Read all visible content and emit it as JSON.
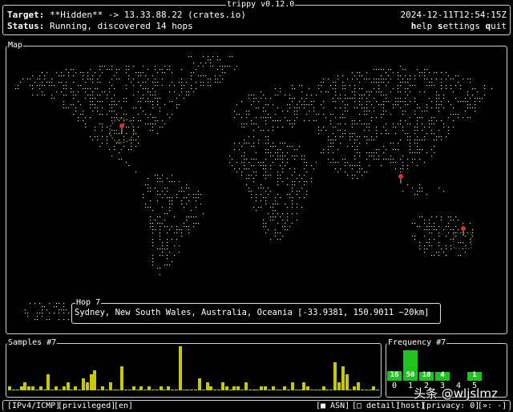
{
  "header": {
    "title": "trippy v0.12.0",
    "target_label": "Target:",
    "target_value": "**Hidden** -> 13.33.88.22 (crates.io)",
    "status_label": "Status:",
    "status_value": "Running, discovered 14 hops",
    "timestamp": "2024-12-11T12:54:15Z",
    "help_h": "h",
    "help_rest": "elp ",
    "settings_s": "s",
    "settings_rest": "ettings ",
    "quit_q": "q",
    "quit_rest": "uit"
  },
  "map": {
    "title": "Map",
    "popup_title": "Hop 7",
    "popup_text": "Sydney, New South Wales, Australia, Oceania [-33.9381, 150.9011 ~20km]",
    "marker_color": "#e03030",
    "ring_color": "#9a9a2a",
    "dot_color": "#d8d8d8"
  },
  "samples": {
    "title": "Samples #7",
    "bar_color": "#c8c80a",
    "values": [
      1,
      0,
      0,
      1,
      2,
      1,
      1,
      0,
      1,
      0,
      4,
      0,
      1,
      0,
      1,
      2,
      0,
      1,
      0,
      3,
      2,
      4,
      5,
      0,
      1,
      0,
      2,
      0,
      0,
      6,
      0,
      0,
      1,
      0,
      1,
      0,
      1,
      0,
      0,
      1,
      0,
      1,
      0,
      0,
      11,
      0,
      0,
      0,
      0,
      3,
      0,
      2,
      1,
      0,
      0,
      2,
      1,
      0,
      1,
      1,
      0,
      2,
      0,
      0,
      0,
      1,
      1,
      0,
      1,
      0,
      0,
      1,
      0,
      2,
      0,
      0,
      2,
      1,
      0,
      0,
      0,
      1,
      0,
      0,
      7,
      2,
      6,
      4,
      0,
      1,
      2,
      0,
      0,
      0,
      1,
      0
    ]
  },
  "frequency": {
    "title": "Frequency #7",
    "bar_color": "#1fc21f",
    "bars": [
      {
        "value": 16,
        "label": "16",
        "tick": "0"
      },
      {
        "value": 50,
        "label": "50",
        "tick": "1"
      },
      {
        "value": 10,
        "label": "10",
        "tick": "2"
      },
      {
        "value": 4,
        "label": "4",
        "tick": "3"
      },
      {
        "value": 0,
        "label": "",
        "tick": "4"
      },
      {
        "value": 1,
        "label": "1",
        "tick": "5"
      }
    ]
  },
  "footer": {
    "protocol": "[IPv4/ICMP]",
    "privileged": "[privileged]",
    "locale": "[en]",
    "asn": "[■ ASN]",
    "detail": "[□ detail]",
    "host": "[host]",
    "privacy": "[privacy: 0]",
    "last": "[»: -]"
  },
  "watermark": "头条 @wljslmz"
}
